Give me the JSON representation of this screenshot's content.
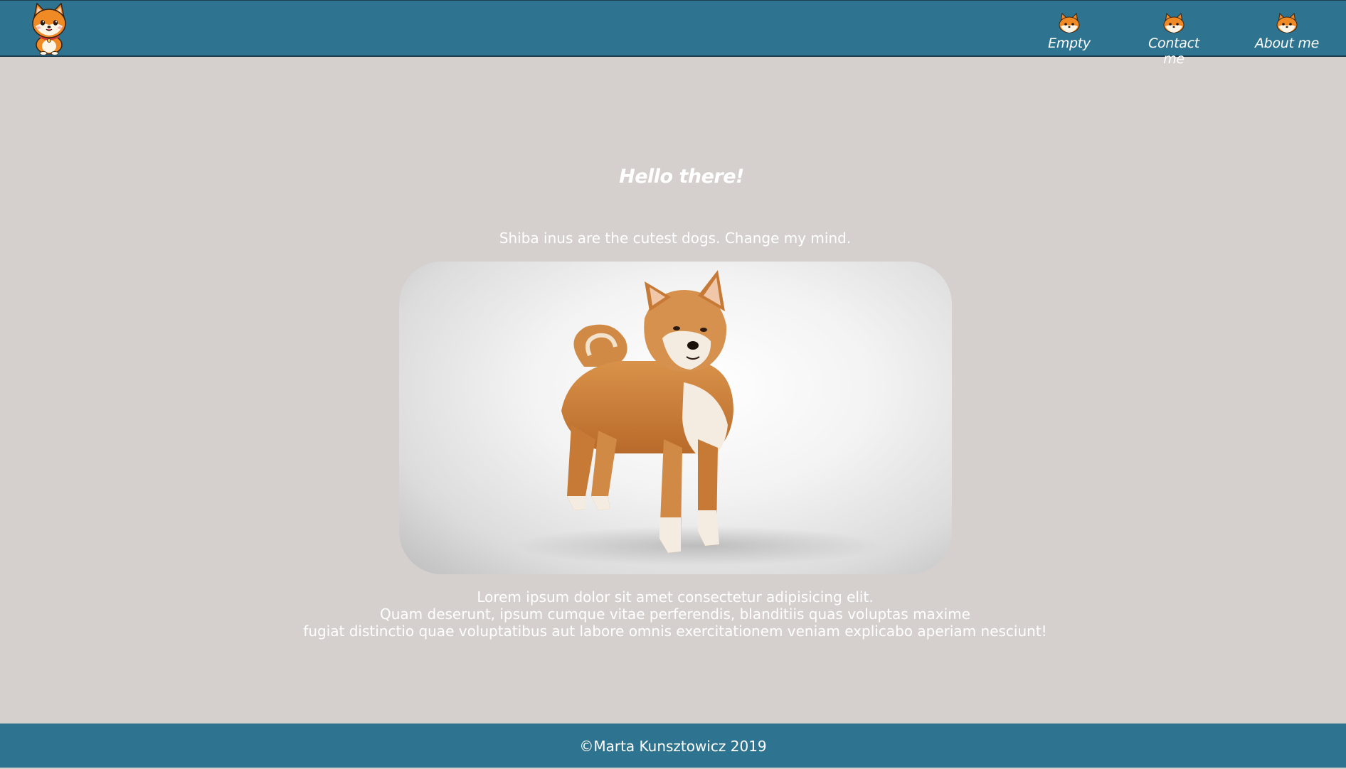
{
  "header": {
    "logo_icon": "shiba-logo-icon",
    "nav": [
      {
        "label": "Empty",
        "icon": "shiba-head-icon"
      },
      {
        "label": "Contact me",
        "icon": "shiba-head-icon"
      },
      {
        "label": "About me",
        "icon": "shiba-head-icon"
      }
    ],
    "background_color": "#2e7490"
  },
  "main": {
    "title": "Hello there!",
    "subtitle": "Shiba inus are the cutest dogs. Change my mind.",
    "image_subject": "shiba-inu-photo",
    "paragraph_lines": [
      "Lorem ipsum dolor sit amet consectetur adipisicing elit.",
      "Quam deserunt, ipsum cumque vitae perferendis, blanditiis quas voluptas maxime",
      "fugiat distinctio quae voluptatibus aut labore omnis exercitationem veniam explicabo aperiam nesciunt!"
    ],
    "background_color": "#d5d0cd"
  },
  "footer": {
    "text": "©Marta Kunsztowicz 2019"
  }
}
